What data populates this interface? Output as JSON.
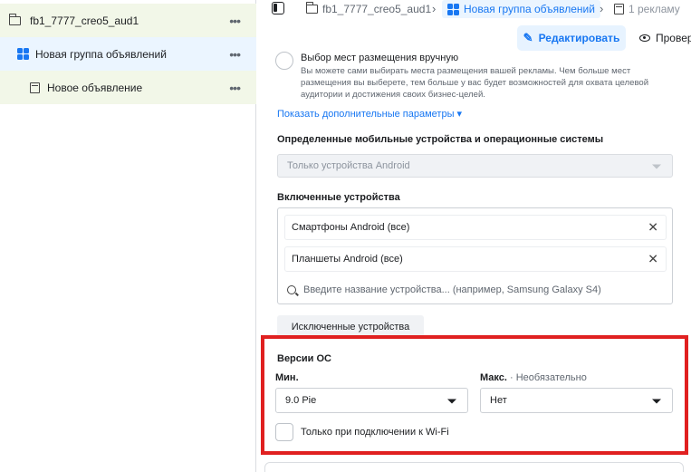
{
  "tree": {
    "campaign": {
      "label": "fb1_7777_creo5_aud1",
      "menu": "•••"
    },
    "adset": {
      "label": "Новая группа объявлений",
      "menu": "•••"
    },
    "ad": {
      "label": "Новое объявление",
      "menu": "•••"
    }
  },
  "breadcrumb": {
    "campaign": "fb1_7777_creo5_aud1",
    "adset": "Новая группа объявлений",
    "ad": "1 рекламу",
    "separator": "›"
  },
  "toolbar": {
    "edit_label": "Редактировать",
    "preview_label": "Проверить"
  },
  "placements": {
    "manual_title": "Выбор мест размещения вручную",
    "manual_desc": "Вы можете сами выбирать места размещения вашей рекламы. Чем больше мест размещения вы выберете, тем больше у вас будет возможностей для охвата целевой аудитории и достижения своих бизнес-целей.",
    "more_options": "Показать дополнительные параметры ▾"
  },
  "devices": {
    "section_label": "Определенные мобильные устройства и операционные системы",
    "os_select_value": "Только устройства Android",
    "included_label": "Включенные устройства",
    "chips": [
      "Смартфоны Android (все)",
      "Планшеты Android (все)"
    ],
    "search_placeholder": "Введите название устройства... (например, Samsung Galaxy S4)",
    "excluded_button": "Исключенные устройства"
  },
  "os_versions": {
    "title": "Версии ОС",
    "min_label": "Мин.",
    "max_label": "Макс.",
    "optional_label": "· Необязательно",
    "min_value": "9.0 Pie",
    "max_value": "Нет",
    "wifi_label": "Только при подключении к Wi-Fi"
  },
  "colors": {
    "accent": "#1877f2",
    "highlight": "#e02020",
    "campaign_bg": "#f2f7e8",
    "adset_bg": "#ebf5ff"
  }
}
